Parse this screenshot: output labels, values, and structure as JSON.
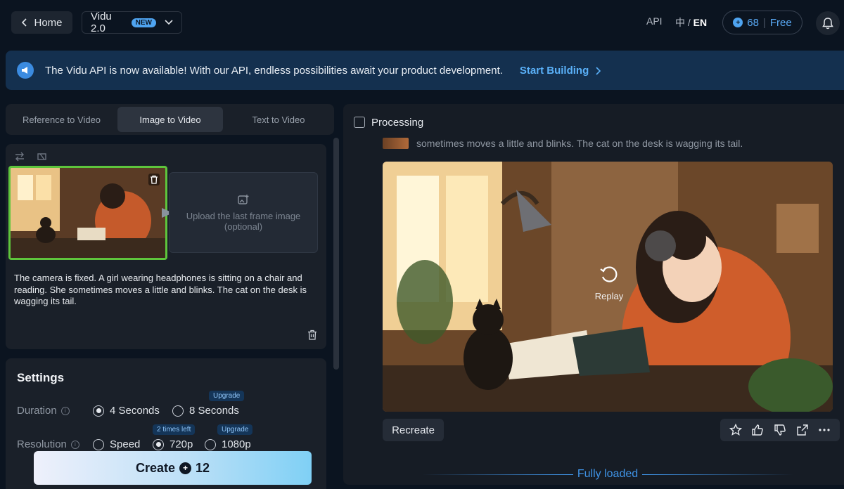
{
  "header": {
    "home_label": "Home",
    "model_label": "Vidu 2.0",
    "new_badge": "NEW",
    "api_label": "API",
    "lang_zh": "中",
    "lang_sep": "/",
    "lang_en": "EN",
    "credits": "68",
    "plan": "Free"
  },
  "banner": {
    "text": "The Vidu API is now available! With our API, endless possibilities await your product development.",
    "cta": "Start Building"
  },
  "tabs": [
    {
      "label": "Reference to Video",
      "active": false
    },
    {
      "label": "Image to Video",
      "active": true
    },
    {
      "label": "Text to Video",
      "active": false
    }
  ],
  "upload": {
    "last_frame_label": "Upload the last frame image\n(optional)"
  },
  "prompt": "The camera is fixed. A girl wearing headphones is sitting on a chair and reading. She sometimes moves a little and blinks. The cat on the desk is wagging its tail.",
  "settings": {
    "title": "Settings",
    "duration_label": "Duration",
    "duration_options": [
      {
        "label": "4 Seconds",
        "selected": true
      },
      {
        "label": "8 Seconds",
        "selected": false,
        "badge": "Upgrade"
      }
    ],
    "resolution_label": "Resolution",
    "resolution_options": [
      {
        "label": "Speed",
        "selected": false
      },
      {
        "label": "720p",
        "selected": true,
        "badge": "2 times left"
      },
      {
        "label": "1080p",
        "selected": false,
        "badge": "Upgrade"
      }
    ]
  },
  "create": {
    "label": "Create",
    "cost": "12"
  },
  "result": {
    "status": "Processing",
    "prompt_cut": "sometimes moves a little and blinks. The cat on the desk is wagging its tail.",
    "replay_label": "Replay",
    "recreate_label": "Recreate",
    "footer": "Fully loaded"
  },
  "icons": [
    "chevron-left-icon",
    "chevron-down-icon",
    "credit-icon",
    "bell-icon",
    "megaphone-icon",
    "chevron-right-icon",
    "swap-icon",
    "crop-icon",
    "trash-icon",
    "image-add-icon",
    "info-icon",
    "replay-icon",
    "star-icon",
    "thumbs-up-icon",
    "thumbs-down-icon",
    "share-icon",
    "more-icon"
  ],
  "colors": {
    "accent": "#4fa4f0",
    "selected_frame": "#5ec53c",
    "background": "#0b1420",
    "banner": "#14304f"
  }
}
